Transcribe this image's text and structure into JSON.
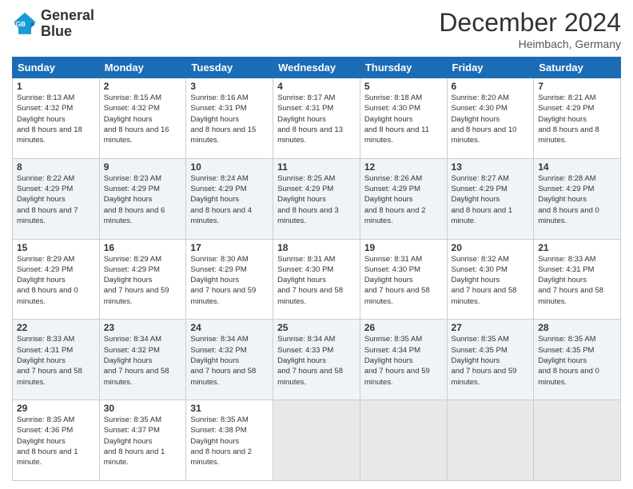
{
  "header": {
    "logo_line1": "General",
    "logo_line2": "Blue",
    "month": "December 2024",
    "location": "Heimbach, Germany"
  },
  "weekdays": [
    "Sunday",
    "Monday",
    "Tuesday",
    "Wednesday",
    "Thursday",
    "Friday",
    "Saturday"
  ],
  "weeks": [
    [
      {
        "day": 1,
        "sunrise": "8:13 AM",
        "sunset": "4:32 PM",
        "daylight": "8 hours and 18 minutes."
      },
      {
        "day": 2,
        "sunrise": "8:15 AM",
        "sunset": "4:32 PM",
        "daylight": "8 hours and 16 minutes."
      },
      {
        "day": 3,
        "sunrise": "8:16 AM",
        "sunset": "4:31 PM",
        "daylight": "8 hours and 15 minutes."
      },
      {
        "day": 4,
        "sunrise": "8:17 AM",
        "sunset": "4:31 PM",
        "daylight": "8 hours and 13 minutes."
      },
      {
        "day": 5,
        "sunrise": "8:18 AM",
        "sunset": "4:30 PM",
        "daylight": "8 hours and 11 minutes."
      },
      {
        "day": 6,
        "sunrise": "8:20 AM",
        "sunset": "4:30 PM",
        "daylight": "8 hours and 10 minutes."
      },
      {
        "day": 7,
        "sunrise": "8:21 AM",
        "sunset": "4:29 PM",
        "daylight": "8 hours and 8 minutes."
      }
    ],
    [
      {
        "day": 8,
        "sunrise": "8:22 AM",
        "sunset": "4:29 PM",
        "daylight": "8 hours and 7 minutes."
      },
      {
        "day": 9,
        "sunrise": "8:23 AM",
        "sunset": "4:29 PM",
        "daylight": "8 hours and 6 minutes."
      },
      {
        "day": 10,
        "sunrise": "8:24 AM",
        "sunset": "4:29 PM",
        "daylight": "8 hours and 4 minutes."
      },
      {
        "day": 11,
        "sunrise": "8:25 AM",
        "sunset": "4:29 PM",
        "daylight": "8 hours and 3 minutes."
      },
      {
        "day": 12,
        "sunrise": "8:26 AM",
        "sunset": "4:29 PM",
        "daylight": "8 hours and 2 minutes."
      },
      {
        "day": 13,
        "sunrise": "8:27 AM",
        "sunset": "4:29 PM",
        "daylight": "8 hours and 1 minute."
      },
      {
        "day": 14,
        "sunrise": "8:28 AM",
        "sunset": "4:29 PM",
        "daylight": "8 hours and 0 minutes."
      }
    ],
    [
      {
        "day": 15,
        "sunrise": "8:29 AM",
        "sunset": "4:29 PM",
        "daylight": "8 hours and 0 minutes."
      },
      {
        "day": 16,
        "sunrise": "8:29 AM",
        "sunset": "4:29 PM",
        "daylight": "7 hours and 59 minutes."
      },
      {
        "day": 17,
        "sunrise": "8:30 AM",
        "sunset": "4:29 PM",
        "daylight": "7 hours and 59 minutes."
      },
      {
        "day": 18,
        "sunrise": "8:31 AM",
        "sunset": "4:30 PM",
        "daylight": "7 hours and 58 minutes."
      },
      {
        "day": 19,
        "sunrise": "8:31 AM",
        "sunset": "4:30 PM",
        "daylight": "7 hours and 58 minutes."
      },
      {
        "day": 20,
        "sunrise": "8:32 AM",
        "sunset": "4:30 PM",
        "daylight": "7 hours and 58 minutes."
      },
      {
        "day": 21,
        "sunrise": "8:33 AM",
        "sunset": "4:31 PM",
        "daylight": "7 hours and 58 minutes."
      }
    ],
    [
      {
        "day": 22,
        "sunrise": "8:33 AM",
        "sunset": "4:31 PM",
        "daylight": "7 hours and 58 minutes."
      },
      {
        "day": 23,
        "sunrise": "8:34 AM",
        "sunset": "4:32 PM",
        "daylight": "7 hours and 58 minutes."
      },
      {
        "day": 24,
        "sunrise": "8:34 AM",
        "sunset": "4:32 PM",
        "daylight": "7 hours and 58 minutes."
      },
      {
        "day": 25,
        "sunrise": "8:34 AM",
        "sunset": "4:33 PM",
        "daylight": "7 hours and 58 minutes."
      },
      {
        "day": 26,
        "sunrise": "8:35 AM",
        "sunset": "4:34 PM",
        "daylight": "7 hours and 59 minutes."
      },
      {
        "day": 27,
        "sunrise": "8:35 AM",
        "sunset": "4:35 PM",
        "daylight": "7 hours and 59 minutes."
      },
      {
        "day": 28,
        "sunrise": "8:35 AM",
        "sunset": "4:35 PM",
        "daylight": "8 hours and 0 minutes."
      }
    ],
    [
      {
        "day": 29,
        "sunrise": "8:35 AM",
        "sunset": "4:36 PM",
        "daylight": "8 hours and 1 minute."
      },
      {
        "day": 30,
        "sunrise": "8:35 AM",
        "sunset": "4:37 PM",
        "daylight": "8 hours and 1 minute."
      },
      {
        "day": 31,
        "sunrise": "8:35 AM",
        "sunset": "4:38 PM",
        "daylight": "8 hours and 2 minutes."
      },
      null,
      null,
      null,
      null
    ]
  ]
}
